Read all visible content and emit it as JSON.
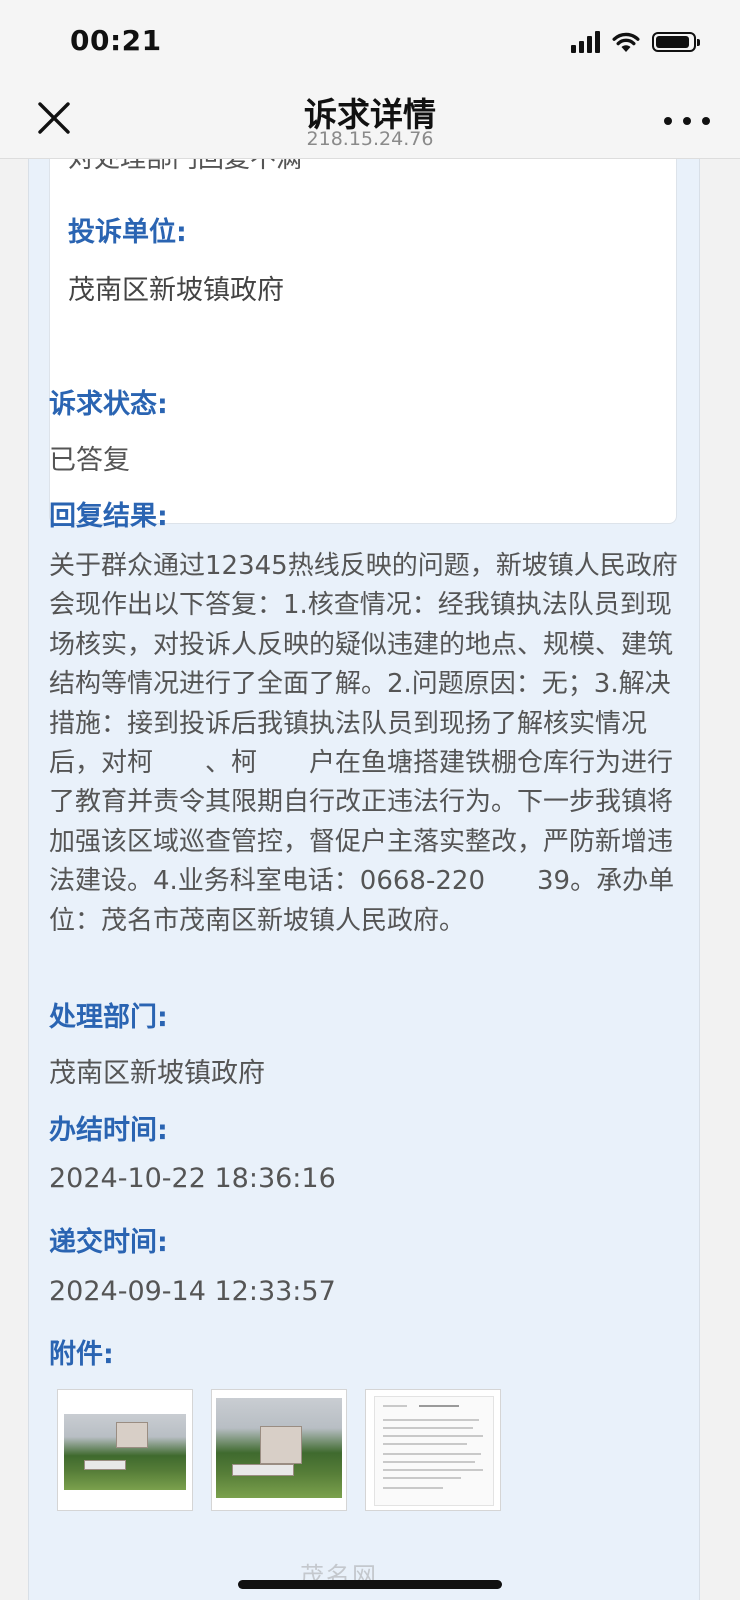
{
  "status_bar": {
    "time": "00:21",
    "battery_level": 0.92,
    "icons": [
      "cellular-signal-icon",
      "wifi-icon",
      "battery-icon"
    ]
  },
  "nav": {
    "title": "诉求详情",
    "subtitle": "218.15.24.76",
    "icons": [
      "close-icon",
      "more-icon"
    ]
  },
  "card": {
    "clipped_text": "对处理部门回复不满",
    "unit_label": "投诉单位:",
    "unit_value": "茂南区新坡镇政府"
  },
  "fields": {
    "status_label": "诉求状态:",
    "status_value": "已答复",
    "reply_label": "回复结果:",
    "reply_text": "关于群众通过12345热线反映的问题，新坡镇人民政府会现作出以下答复：1.核查情况：经我镇执法队员到现场核实，对投诉人反映的疑似违建的地点、规模、建筑结构等情况进行了全面了解。2.问题原因：无；3.解决措施：接到投诉后我镇执法队员到现扬了解核实情况后，对柯　　、柯　　户在鱼塘搭建铁棚仓库行为进行了教育并责令其限期自行改正违法行为。下一步我镇将加强该区域巡查管控，督促户主落实整改，严防新增违法建设。4.业务科室电话：0668-220　　39。承办单位：茂名市茂南区新坡镇人民政府。",
    "dept_label": "处理部门:",
    "dept_value": "茂南区新坡镇政府",
    "closed_label": "办结时间:",
    "closed_value": "2024-10-22 18:36:16",
    "submitted_label": "递交时间:",
    "submitted_value": "2024-09-14 12:33:57",
    "attachments_label": "附件:"
  },
  "attachments": [
    {
      "kind": "photo"
    },
    {
      "kind": "photo"
    },
    {
      "kind": "document"
    }
  ],
  "colors": {
    "label_blue": "#2a64b2",
    "content_bg": "#e9f1fa",
    "text_gray": "#555555"
  }
}
